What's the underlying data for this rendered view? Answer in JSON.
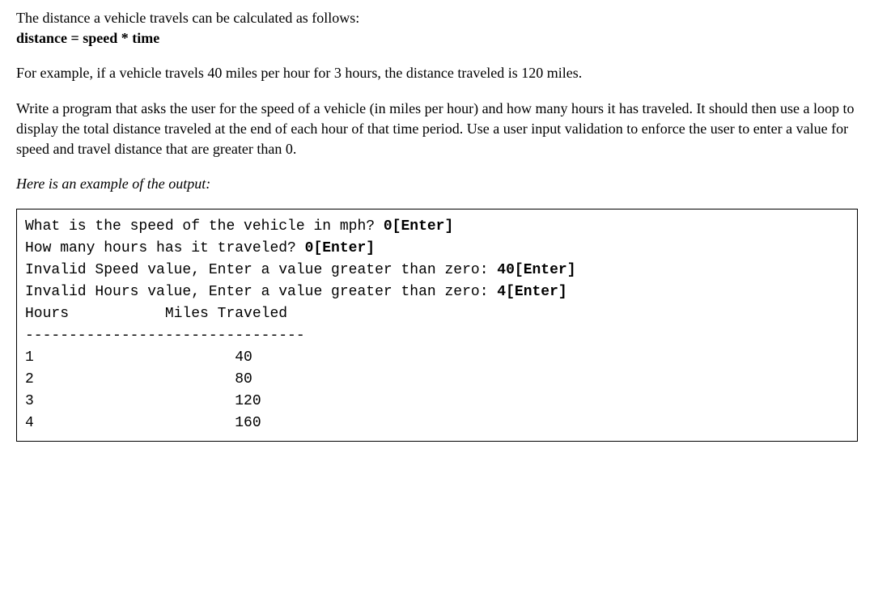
{
  "intro": {
    "line1": "The distance a vehicle travels can be calculated as follows:",
    "formula": "distance = speed * time"
  },
  "example": "For example, if a vehicle travels 40 miles per hour for 3 hours, the distance traveled is 120 miles.",
  "instructions": "Write a program that asks the user for the speed of a vehicle (in miles per hour) and how many hours it has traveled. It should then use a loop to display the total distance traveled at the end of each hour of that time period. Use a user input validation to enforce the user to enter a value for speed and travel distance that are greater than 0.",
  "output_label": "Here is an example of the output:",
  "code": {
    "q1": "What is the speed of the vehicle in mph? ",
    "a1": "0[Enter]",
    "q2": "How many hours has it traveled? ",
    "a2": "0[Enter]",
    "inv1": "Invalid Speed value, Enter a value greater than zero: ",
    "inv1a": "40[Enter]",
    "inv2": "Invalid Hours value, Enter a value greater than zero: ",
    "inv2a": "4[Enter]",
    "header": "Hours           Miles Traveled",
    "divider": "--------------------------------",
    "rows": [
      "1                       40",
      "2                       80",
      "3                       120",
      "4                       160"
    ]
  }
}
